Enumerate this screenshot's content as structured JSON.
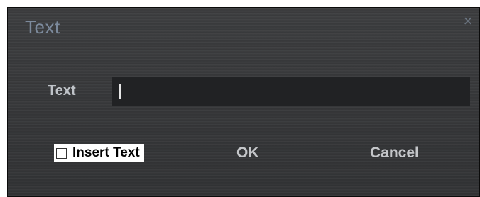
{
  "dialog": {
    "title": "Text",
    "close_icon": "close-icon",
    "close_glyph": "×",
    "field_label": "Text",
    "text_value": "",
    "insert_text_label": "Insert Text",
    "insert_text_checked": false,
    "ok_label": "OK",
    "cancel_label": "Cancel"
  },
  "colors": {
    "background": "#3a3b3d",
    "title": "#7c8a9c",
    "input_background": "#212224",
    "button_text": "#c4c6c9"
  }
}
